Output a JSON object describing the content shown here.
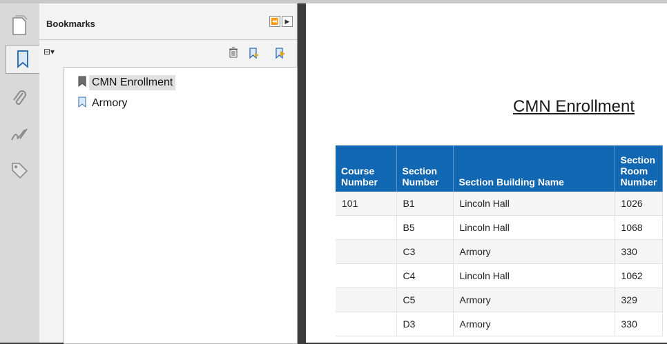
{
  "panel": {
    "title": "Bookmarks",
    "header_buttons": [
      "⏪",
      "▶"
    ],
    "toolbar": {
      "options": "⊟▾"
    }
  },
  "bookmarks": [
    {
      "label": "CMN Enrollment",
      "selected": true
    },
    {
      "label": "Armory",
      "selected": false
    }
  ],
  "tools": [
    "page-thumbnails-icon",
    "bookmark-icon",
    "attachment-icon",
    "signature-icon",
    "tag-icon"
  ],
  "document": {
    "title": "CMN Enrollment",
    "table": {
      "headers": [
        "Course\nNumber",
        "Section\nNumber",
        "Section Building Name",
        "Section\nRoom\nNumber"
      ],
      "rows": [
        [
          "101",
          "B1",
          "Lincoln Hall",
          "1026"
        ],
        [
          "",
          "B5",
          "Lincoln Hall",
          "1068"
        ],
        [
          "",
          "C3",
          "Armory",
          "330"
        ],
        [
          "",
          "C4",
          "Lincoln Hall",
          "1062"
        ],
        [
          "",
          "C5",
          "Armory",
          "329"
        ],
        [
          "",
          "D3",
          "Armory",
          "330"
        ]
      ]
    }
  },
  "colors": {
    "header_blue": "#1167b1",
    "chrome": "#3b3b3b"
  }
}
